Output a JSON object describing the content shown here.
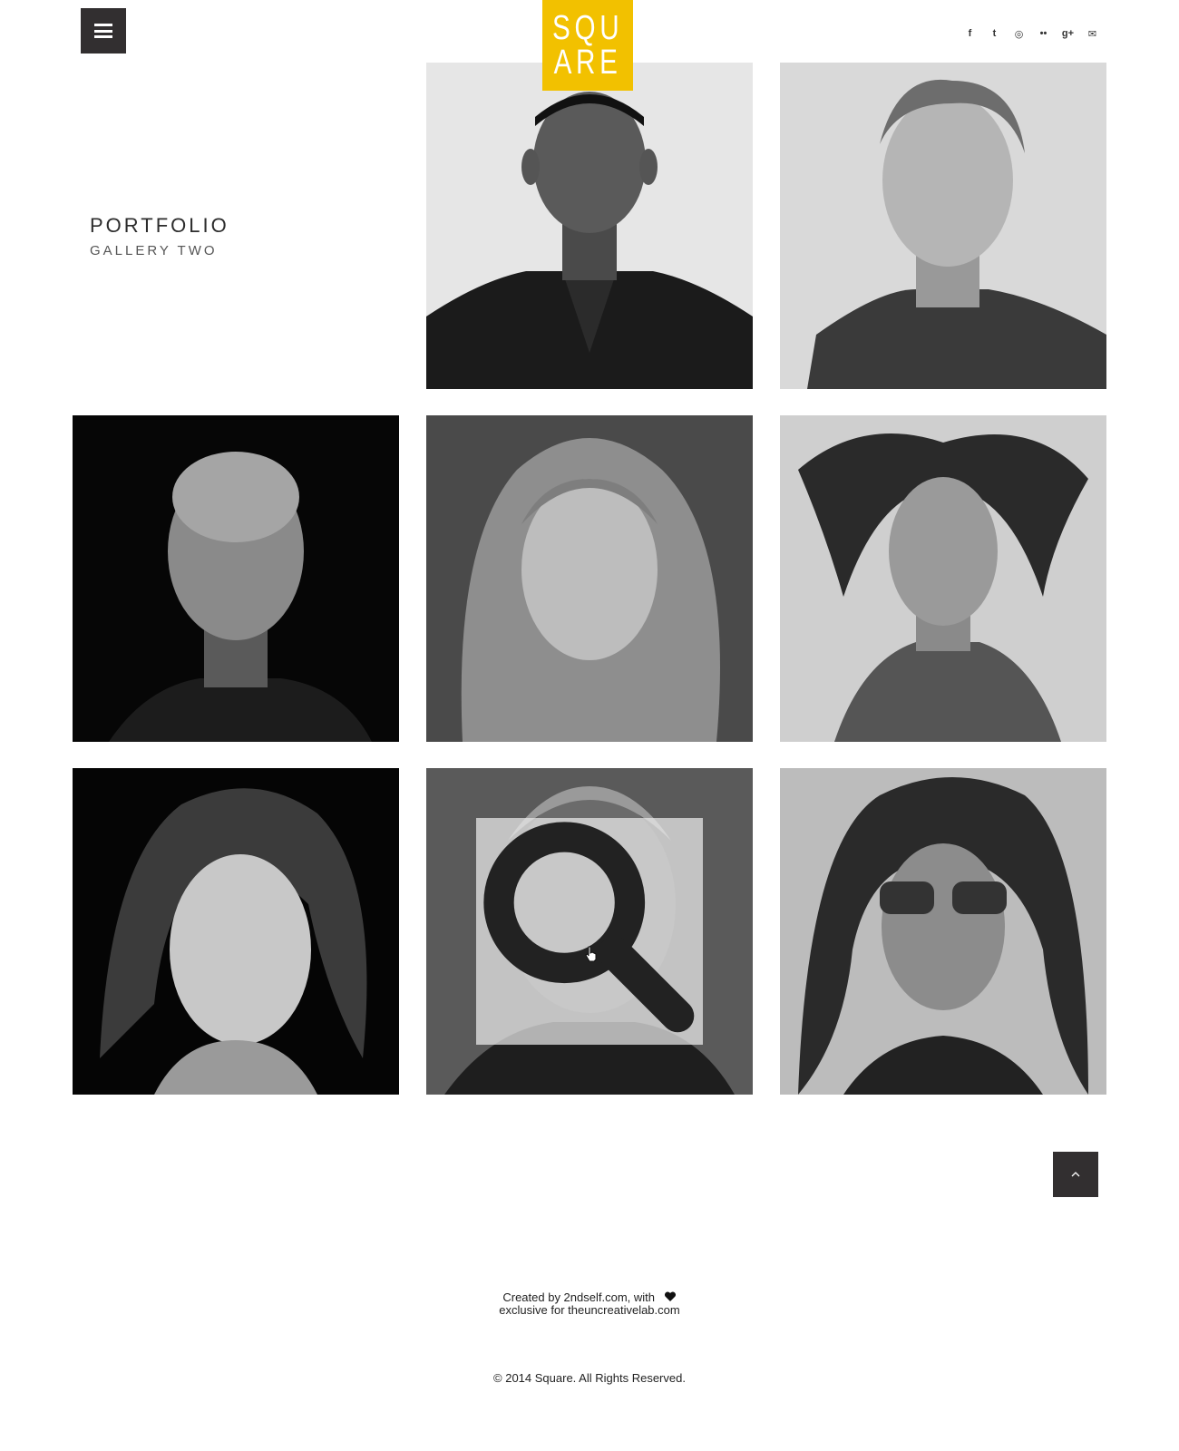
{
  "header": {
    "menu_icon": "hamburger-menu-icon",
    "logo": {
      "line1": "SQU",
      "line2": "ARE",
      "background": "#f2c100",
      "text_color": "#ffffff"
    },
    "social": [
      {
        "name": "facebook-icon",
        "glyph": "f"
      },
      {
        "name": "twitter-icon",
        "glyph": "t"
      },
      {
        "name": "instagram-icon",
        "glyph": "◎"
      },
      {
        "name": "flickr-icon",
        "glyph": "••"
      },
      {
        "name": "google-plus-icon",
        "glyph": "g+"
      },
      {
        "name": "email-icon",
        "glyph": "✉"
      }
    ]
  },
  "page": {
    "title": "PORTFOLIO",
    "subtitle": "GALLERY TWO"
  },
  "gallery": [
    {
      "name": "portrait-1"
    },
    {
      "name": "portrait-2"
    },
    {
      "name": "portrait-3"
    },
    {
      "name": "portrait-4"
    },
    {
      "name": "portrait-5"
    },
    {
      "name": "portrait-6"
    },
    {
      "name": "portrait-7",
      "hovered": true
    },
    {
      "name": "portrait-8"
    }
  ],
  "footer": {
    "credit_line1": "Created by 2ndself.com, with",
    "credit_line2": "exclusive for theuncreativelab.com",
    "copyright": "© 2014 Square. All Rights Reserved.",
    "heart_icon": "heart-icon"
  },
  "colors": {
    "dark_button": "#322f30",
    "accent": "#f2c100"
  }
}
